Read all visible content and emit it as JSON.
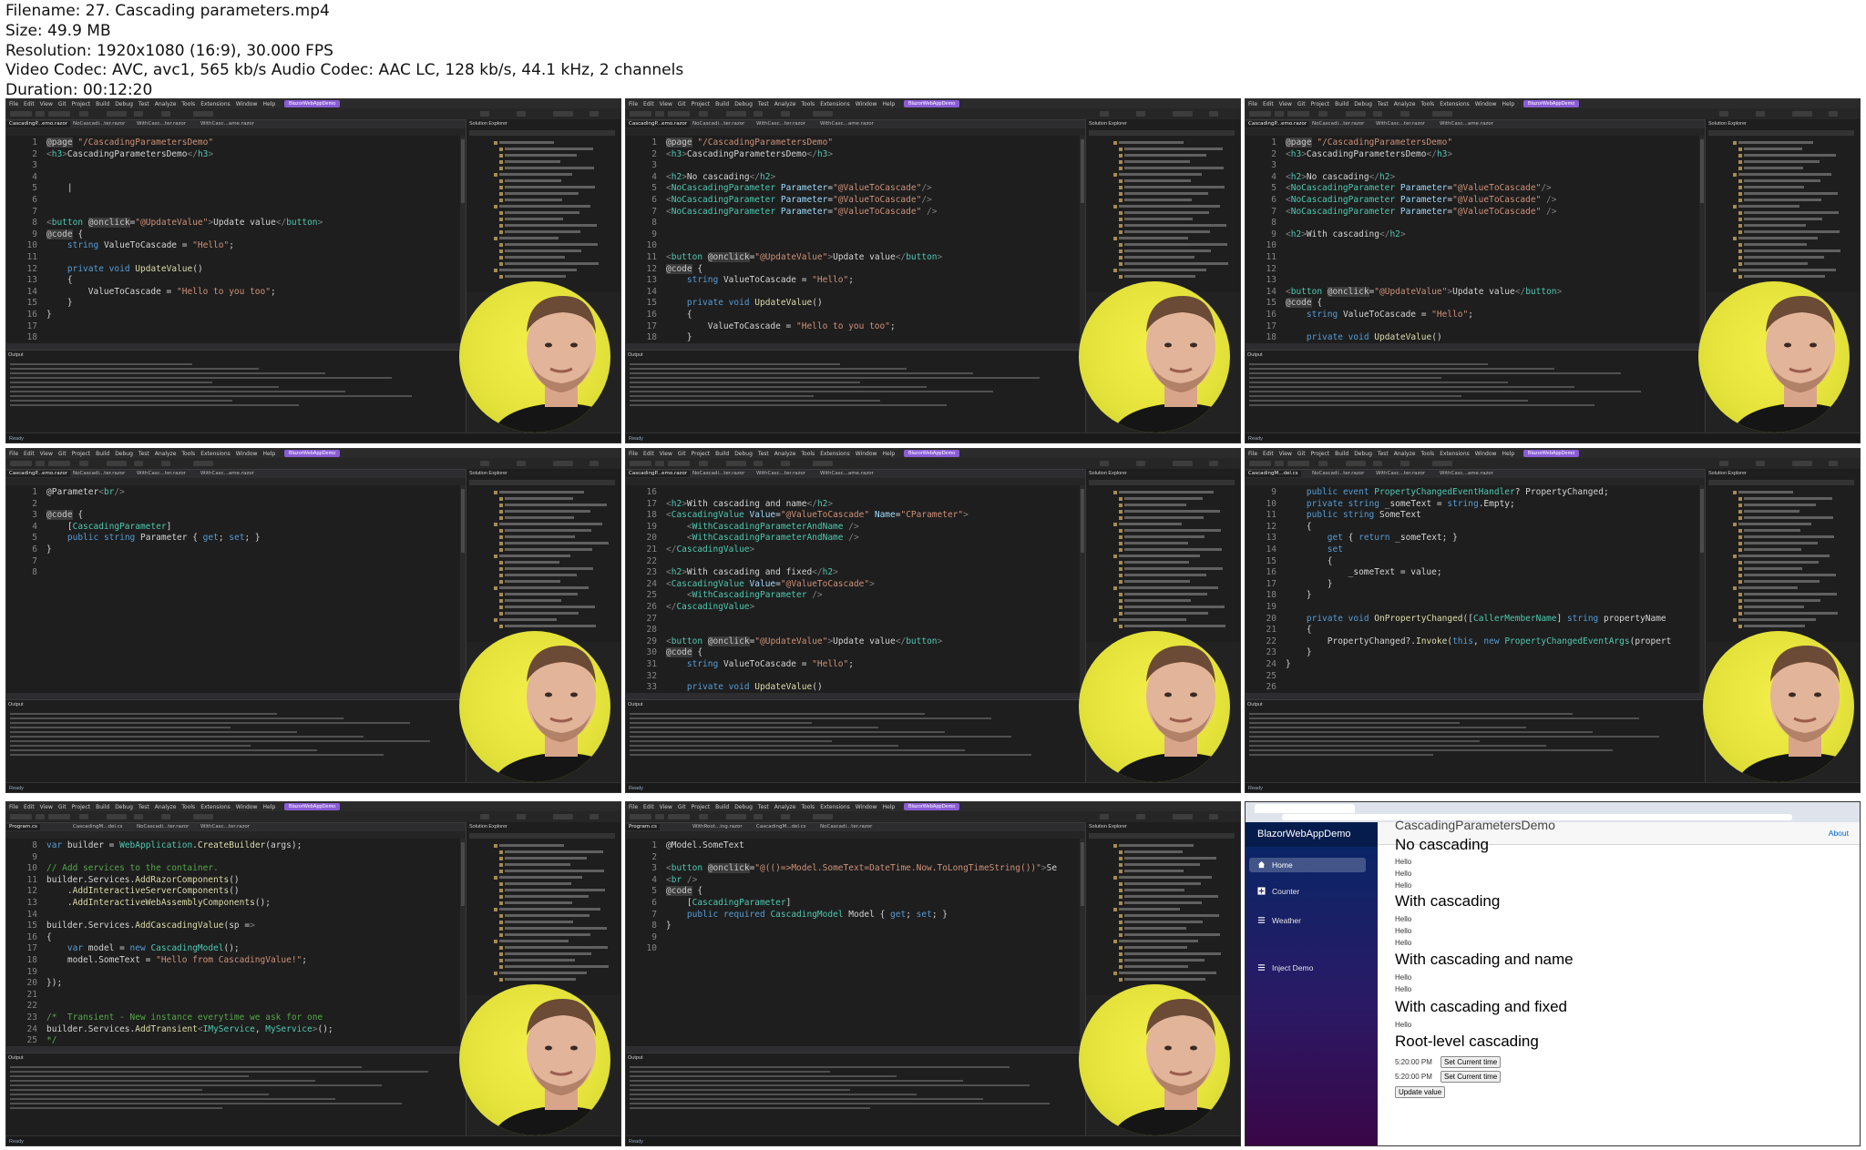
{
  "meta": {
    "filename": "Filename: 27. Cascading parameters.mp4",
    "size": "Size: 49.9 MB",
    "resolution": "Resolution: 1920x1080 (16:9), 30.000 FPS",
    "video": "Video Codec: AVC, avc1, 565 kb/s Audio Codec: AAC LC, 128 kb/s, 44.1 kHz, 2 channels",
    "duration": "Duration: 00:12:20"
  },
  "ide": {
    "menu": [
      "File",
      "Edit",
      "View",
      "Git",
      "Project",
      "Build",
      "Debug",
      "Test",
      "Analyze",
      "Tools",
      "Extensions",
      "Window",
      "Help"
    ],
    "solution_name": "BlazorWebAppDemo",
    "solution_explorer_title": "Solution Explorer",
    "output_title": "Output",
    "status": "Ready"
  },
  "thumbs": [
    {
      "tabs": [
        "CascadingP...emo.razor",
        "NoCascadi...ter.razor",
        "WithCasc...ter.razor",
        "WithCasc...ame.razor"
      ],
      "lines": [
        {
          "n": "1",
          "c": "@page \"/CascadingParametersDemo\""
        },
        {
          "n": "2",
          "c": "<h3>CascadingParametersDemo</h3>"
        },
        {
          "n": "3",
          "c": ""
        },
        {
          "n": "4",
          "c": ""
        },
        {
          "n": "5",
          "c": "    |"
        },
        {
          "n": "6",
          "c": ""
        },
        {
          "n": "7",
          "c": ""
        },
        {
          "n": "8",
          "c": "<button @onclick=\"@UpdateValue\">Update value</button>"
        },
        {
          "n": "9",
          "c": "@code {"
        },
        {
          "n": "10",
          "c": "    string ValueToCascade = \"Hello\";"
        },
        {
          "n": "11",
          "c": ""
        },
        {
          "n": "12",
          "c": "    private void UpdateValue()"
        },
        {
          "n": "13",
          "c": "    {"
        },
        {
          "n": "14",
          "c": "        ValueToCascade = \"Hello to you too\";"
        },
        {
          "n": "15",
          "c": "    }"
        },
        {
          "n": "16",
          "c": "}"
        },
        {
          "n": "17",
          "c": ""
        },
        {
          "n": "18",
          "c": ""
        }
      ]
    },
    {
      "tabs": [
        "CascadingP...emo.razor",
        "NoCascadi...ter.razor",
        "WithCasc...ter.razor",
        "WithCasc...ame.razor"
      ],
      "lines": [
        {
          "n": "1",
          "c": "@page \"/CascadingParametersDemo\""
        },
        {
          "n": "2",
          "c": "<h3>CascadingParametersDemo</h3>"
        },
        {
          "n": "3",
          "c": ""
        },
        {
          "n": "4",
          "c": "<h2>No cascading</h2>"
        },
        {
          "n": "5",
          "c": "<NoCascadingParameter Parameter=\"@ValueToCascade\"/>"
        },
        {
          "n": "6",
          "c": "<NoCascadingParameter Parameter=\"@ValueToCascade\"/>"
        },
        {
          "n": "7",
          "c": "<NoCascadingParameter Parameter=\"@ValueToCascade\" />"
        },
        {
          "n": "8",
          "c": ""
        },
        {
          "n": "9",
          "c": ""
        },
        {
          "n": "10",
          "c": ""
        },
        {
          "n": "11",
          "c": "<button @onclick=\"@UpdateValue\">Update value</button>"
        },
        {
          "n": "12",
          "c": "@code {"
        },
        {
          "n": "13",
          "c": "    string ValueToCascade = \"Hello\";"
        },
        {
          "n": "14",
          "c": ""
        },
        {
          "n": "15",
          "c": "    private void UpdateValue()"
        },
        {
          "n": "16",
          "c": "    {"
        },
        {
          "n": "17",
          "c": "        ValueToCascade = \"Hello to you too\";"
        },
        {
          "n": "18",
          "c": "    }"
        }
      ]
    },
    {
      "tabs": [
        "CascadingP...emo.razor",
        "NoCascadi...ter.razor",
        "WithCasc...ter.razor",
        "WithCasc...ame.razor"
      ],
      "lines": [
        {
          "n": "1",
          "c": "@page \"/CascadingParametersDemo\""
        },
        {
          "n": "2",
          "c": "<h3>CascadingParametersDemo</h3>"
        },
        {
          "n": "3",
          "c": ""
        },
        {
          "n": "4",
          "c": "<h2>No cascading</h2>"
        },
        {
          "n": "5",
          "c": "<NoCascadingParameter Parameter=\"@ValueToCascade\"/>"
        },
        {
          "n": "6",
          "c": "<NoCascadingParameter Parameter=\"@ValueToCascade\" />"
        },
        {
          "n": "7",
          "c": "<NoCascadingParameter Parameter=\"@ValueToCascade\" />"
        },
        {
          "n": "8",
          "c": ""
        },
        {
          "n": "9",
          "c": "<h2>With cascading</h2>"
        },
        {
          "n": "10",
          "c": ""
        },
        {
          "n": "11",
          "c": ""
        },
        {
          "n": "12",
          "c": ""
        },
        {
          "n": "13",
          "c": ""
        },
        {
          "n": "14",
          "c": "<button @onclick=\"@UpdateValue\">Update value</button>"
        },
        {
          "n": "15",
          "c": "@code {"
        },
        {
          "n": "16",
          "c": "    string ValueToCascade = \"Hello\";"
        },
        {
          "n": "17",
          "c": ""
        },
        {
          "n": "18",
          "c": "    private void UpdateValue()"
        }
      ]
    },
    {
      "tabs": [
        "CascadingP...emo.razor",
        "NoCascadi...ter.razor",
        "WithCasc...ter.razor",
        "WithCasc...ame.razor"
      ],
      "lines": [
        {
          "n": "1",
          "c": "@Parameter<br/>"
        },
        {
          "n": "2",
          "c": ""
        },
        {
          "n": "3",
          "c": "@code {"
        },
        {
          "n": "4",
          "c": "    [CascadingParameter]"
        },
        {
          "n": "5",
          "c": "    public string Parameter { get; set; }"
        },
        {
          "n": "6",
          "c": "}"
        },
        {
          "n": "7",
          "c": ""
        },
        {
          "n": "8",
          "c": ""
        }
      ]
    },
    {
      "tabs": [
        "CascadingP...emo.razor",
        "NoCascadi...ter.razor",
        "WithCasc...ter.razor",
        "WithCasc...ame.razor"
      ],
      "lines": [
        {
          "n": "16",
          "c": ""
        },
        {
          "n": "17",
          "c": "<h2>With cascading and name</h2>"
        },
        {
          "n": "18",
          "c": "<CascadingValue Value=\"@ValueToCascade\" Name=\"CParameter\">"
        },
        {
          "n": "19",
          "c": "    <WithCascadingParameterAndName />"
        },
        {
          "n": "20",
          "c": "    <WithCascadingParameterAndName />"
        },
        {
          "n": "21",
          "c": "</CascadingValue>"
        },
        {
          "n": "22",
          "c": ""
        },
        {
          "n": "23",
          "c": "<h2>With cascading and fixed</h2>"
        },
        {
          "n": "24",
          "c": "<CascadingValue Value=\"@ValueToCascade\">"
        },
        {
          "n": "25",
          "c": "    <WithCascadingParameter />"
        },
        {
          "n": "26",
          "c": "</CascadingValue>"
        },
        {
          "n": "27",
          "c": ""
        },
        {
          "n": "28",
          "c": ""
        },
        {
          "n": "29",
          "c": "<button @onclick=\"@UpdateValue\">Update value</button>"
        },
        {
          "n": "30",
          "c": "@code {"
        },
        {
          "n": "31",
          "c": "    string ValueToCascade = \"Hello\";"
        },
        {
          "n": "32",
          "c": ""
        },
        {
          "n": "33",
          "c": "    private void UpdateValue()"
        }
      ]
    },
    {
      "tabs": [
        "CascadingM...del.cs",
        "NoCascadi...ter.razor",
        "WithCasc...ter.razor",
        "WithCasc...ame.razor"
      ],
      "lines": [
        {
          "n": "9",
          "c": "    public event PropertyChangedEventHandler? PropertyChanged;"
        },
        {
          "n": "10",
          "c": "    private string _someText = string.Empty;"
        },
        {
          "n": "11",
          "c": "    public string SomeText"
        },
        {
          "n": "12",
          "c": "    {"
        },
        {
          "n": "13",
          "c": "        get { return _someText; }"
        },
        {
          "n": "14",
          "c": "        set"
        },
        {
          "n": "15",
          "c": "        {"
        },
        {
          "n": "16",
          "c": "            _someText = value;"
        },
        {
          "n": "17",
          "c": "        }"
        },
        {
          "n": "18",
          "c": "    }"
        },
        {
          "n": "19",
          "c": ""
        },
        {
          "n": "20",
          "c": "    private void OnPropertyChanged([CallerMemberName] string propertyName"
        },
        {
          "n": "21",
          "c": "    {"
        },
        {
          "n": "22",
          "c": "        PropertyChanged?.Invoke(this, new PropertyChangedEventArgs(propert"
        },
        {
          "n": "23",
          "c": "    }"
        },
        {
          "n": "24",
          "c": "}"
        },
        {
          "n": "25",
          "c": ""
        },
        {
          "n": "26",
          "c": ""
        }
      ]
    },
    {
      "tabs": [
        "Program.cs",
        "CascadingM...del.cs",
        "NoCascadi...ter.razor",
        "WithCasc...ter.razor"
      ],
      "lines": [
        {
          "n": "8",
          "c": "var builder = WebApplication.CreateBuilder(args);"
        },
        {
          "n": "9",
          "c": ""
        },
        {
          "n": "10",
          "c": "// Add services to the container."
        },
        {
          "n": "11",
          "c": "builder.Services.AddRazorComponents()"
        },
        {
          "n": "12",
          "c": "    .AddInteractiveServerComponents()"
        },
        {
          "n": "13",
          "c": "    .AddInteractiveWebAssemblyComponents();"
        },
        {
          "n": "14",
          "c": ""
        },
        {
          "n": "15",
          "c": "builder.Services.AddCascadingValue(sp =>"
        },
        {
          "n": "16",
          "c": "{"
        },
        {
          "n": "17",
          "c": "    var model = new CascadingModel();"
        },
        {
          "n": "18",
          "c": "    model.SomeText = \"Hello from CascadingValue!\";"
        },
        {
          "n": "19",
          "c": ""
        },
        {
          "n": "20",
          "c": "});"
        },
        {
          "n": "21",
          "c": ""
        },
        {
          "n": "22",
          "c": ""
        },
        {
          "n": "23",
          "c": "/*  Transient - New instance everytime we ask for one"
        },
        {
          "n": "24",
          "c": "builder.Services.AddTransient<IMyService, MyService>();"
        },
        {
          "n": "25",
          "c": "*/"
        }
      ]
    },
    {
      "tabs": [
        "Program.cs",
        "WithRoot...ing.razor",
        "CascadingM...del.cs",
        "NoCascadi...ter.razor"
      ],
      "lines": [
        {
          "n": "1",
          "c": "@Model.SomeText"
        },
        {
          "n": "2",
          "c": ""
        },
        {
          "n": "3",
          "c": "<button @onclick=\"@(()=>Model.SomeText=DateTime.Now.ToLongTimeString())\">Se"
        },
        {
          "n": "4",
          "c": "<br />"
        },
        {
          "n": "5",
          "c": "@code {"
        },
        {
          "n": "6",
          "c": "    [CascadingParameter]"
        },
        {
          "n": "7",
          "c": "    public required CascadingModel Model { get; set; }"
        },
        {
          "n": "8",
          "c": "}"
        },
        {
          "n": "9",
          "c": ""
        },
        {
          "n": "10",
          "c": ""
        }
      ]
    }
  ],
  "browser": {
    "brand": "BlazorWebAppDemo",
    "nav": [
      "Home",
      "Counter",
      "Weather",
      "Inject Demo"
    ],
    "about": "About",
    "content": {
      "cut_heading": "CascadingParametersDemo",
      "h_no": "No cascading",
      "h_with": "With cascading",
      "h_name": "With cascading and name",
      "h_fixed": "With cascading and fixed",
      "h_root": "Root-level cascading",
      "hello": "Hello",
      "time1": "5:20:00 PM",
      "time2": "5:20:00 PM",
      "set_button": "Set Current time",
      "update_button": "Update value"
    }
  }
}
